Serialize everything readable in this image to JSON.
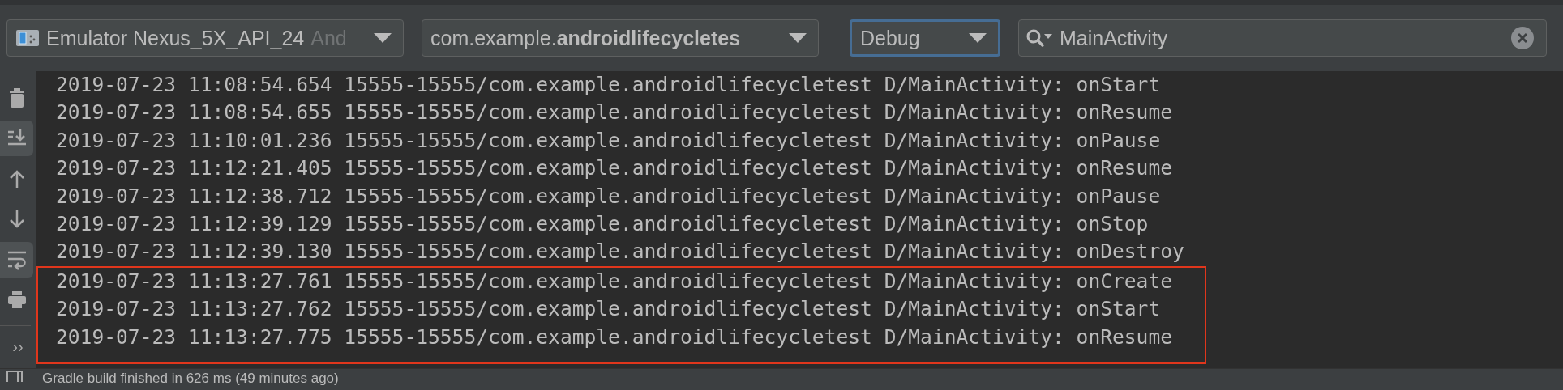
{
  "toolbar": {
    "device": {
      "name": "Emulator Nexus_5X_API_24",
      "detail": "And"
    },
    "process": {
      "value": "com.example.**androidlifecycletes**"
    },
    "log_level": {
      "value": "Debug",
      "focused": true
    },
    "search": {
      "value": "MainActivity"
    }
  },
  "side_tools": [
    {
      "kind": "trash",
      "selected": false
    },
    {
      "kind": "scroll-end",
      "selected": true
    },
    {
      "kind": "up",
      "selected": false
    },
    {
      "kind": "down",
      "selected": false
    },
    {
      "kind": "wrap",
      "selected": true
    },
    {
      "kind": "print",
      "selected": false
    }
  ],
  "more": "››",
  "log_rows": [
    "2019-07-23 11:08:54.654 15555-15555/com.example.androidlifecycletest D/MainActivity: onStart",
    "2019-07-23 11:08:54.655 15555-15555/com.example.androidlifecycletest D/MainActivity: onResume",
    "2019-07-23 11:10:01.236 15555-15555/com.example.androidlifecycletest D/MainActivity: onPause",
    "2019-07-23 11:12:21.405 15555-15555/com.example.androidlifecycletest D/MainActivity: onResume",
    "2019-07-23 11:12:38.712 15555-15555/com.example.androidlifecycletest D/MainActivity: onPause",
    "2019-07-23 11:12:39.129 15555-15555/com.example.androidlifecycletest D/MainActivity: onStop",
    "2019-07-23 11:12:39.130 15555-15555/com.example.androidlifecycletest D/MainActivity: onDestroy"
  ],
  "highlight_frame": {
    "rows": [
      "2019-07-23 11:13:27.761 15555-15555/com.example.androidlifecycletest D/MainActivity: onCreate",
      "2019-07-23 11:13:27.762 15555-15555/com.example.androidlifecycletest D/MainActivity: onStart",
      "2019-07-23 11:13:27.775 15555-15555/com.example.androidlifecycletest D/MainActivity: onResume"
    ]
  },
  "status_bar": {
    "text": "Gradle build finished in 626 ms (49 minutes ago)"
  }
}
